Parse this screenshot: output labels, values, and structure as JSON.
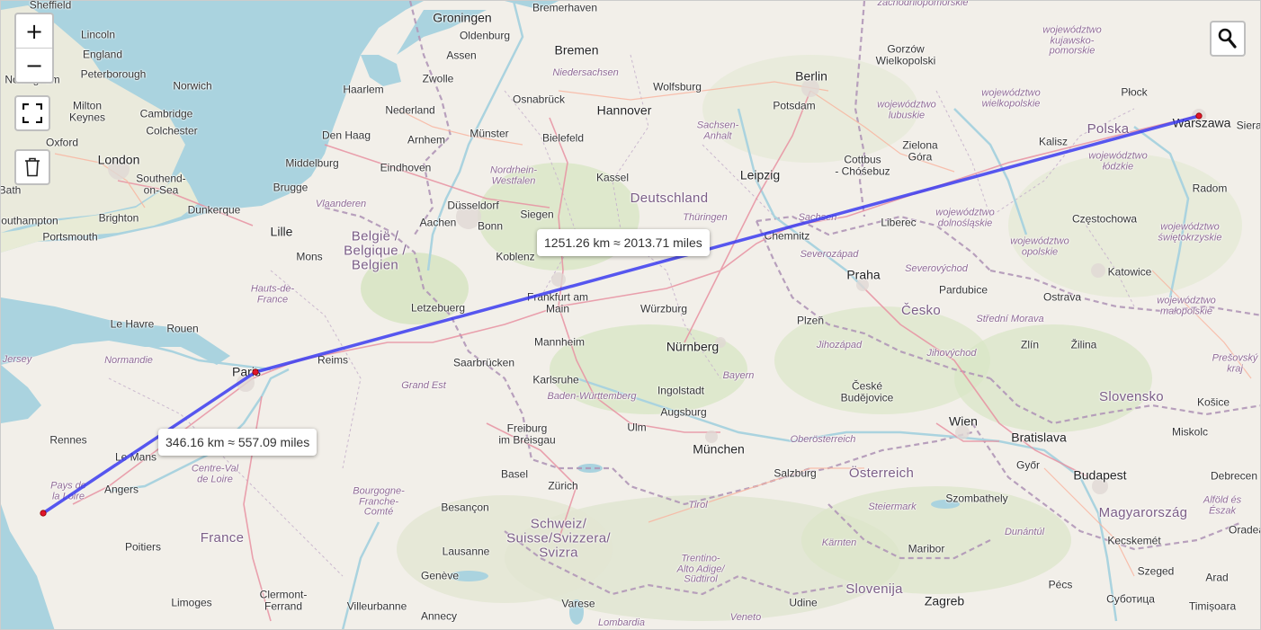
{
  "controls": {
    "zoom_in": "+",
    "zoom_out": "−",
    "fullscreen_icon": "fullscreen-icon",
    "delete_icon": "trash-icon",
    "search_icon": "search-icon"
  },
  "measurements": [
    {
      "text": "1251.26 km ≈ 2013.71 miles"
    },
    {
      "text": "346.16 km ≈ 557.09 miles"
    }
  ],
  "route": {
    "color": "#3b3bf0",
    "points": [
      "Nantes",
      "Paris",
      "Warszawa"
    ]
  },
  "labels": {
    "cities": [
      "Sheffield",
      "Lincoln",
      "Nottingham",
      "England",
      "Peterborough",
      "Norwich",
      "Milton Keynes",
      "Cambridge",
      "Colchester",
      "Oxford",
      "London",
      "Southend-on-Sea",
      "Bath",
      "Southampton",
      "Brighton",
      "Portsmouth",
      "Groningen",
      "Bremerhaven",
      "Oldenburg",
      "Bremen",
      "Assen",
      "Haarlem",
      "Zwolle",
      "Nederland",
      "Osnabrück",
      "Wolfsburg",
      "Hannover",
      "Berlin",
      "Potsdam",
      "Den Haag",
      "Arnhem",
      "Münster",
      "Bielefeld",
      "Middelburg",
      "Eindhoven",
      "Brugge",
      "Düsseldorf",
      "Kassel",
      "Leipzig",
      "Dunkerque",
      "Aachen",
      "Bonn",
      "Siegen",
      "Lille",
      "Mons",
      "Koblenz",
      "Letzebuerg",
      "Frankfurt am Main",
      "Würzburg",
      "Mannheim",
      "Saarbrücken",
      "Nürnberg",
      "Karlsruhe",
      "Ingolstadt",
      "Augsburg",
      "Freiburg im Breisgau",
      "Ulm",
      "München",
      "Reims",
      "Paris",
      "Le Havre",
      "Rouen",
      "Rennes",
      "Le Mans",
      "Angers",
      "Poitiers",
      "Limoges",
      "Clermont-Ferrand",
      "Villeurbanne",
      "Annecy",
      "Besançon",
      "Basel",
      "Zürich",
      "Lausanne",
      "Genève",
      "Varese",
      "Chemnitz",
      "Praha",
      "Pardubice",
      "Plzeň",
      "České Budějovice",
      "Ostrava",
      "Zlín",
      "Žilina",
      "Wien",
      "Bratislava",
      "Győr",
      "Budapest",
      "Salzburg",
      "Maribor",
      "Zagreb",
      "Szombathely",
      "Kecskemét",
      "Szeged",
      "Arad",
      "Debrecen",
      "Miskolc",
      "Košice",
      "Timișoara",
      "Oradea",
      "Pécs",
      "Суботица",
      "Udine",
      "Warszawa",
      "Płock",
      "Kalisz",
      "Radom",
      "Częstochowa",
      "Katowice",
      "Liberec",
      "Zielona Góra",
      "Gorzów Wielkopolski",
      "Cottbus Chóśebuz",
      "Sieradz"
    ],
    "countries": [
      "Deutschland",
      "Polska",
      "Belgique / België / Belgien",
      "France",
      "Česko",
      "Österreich",
      "Slovensko",
      "Magyarország",
      "Slovenija",
      "Schweiz/ Suisse/Svizzera/ Svizra"
    ],
    "regions": [
      "Niedersachsen",
      "Sachsen-Anhalt",
      "Nordrhein-Westfalen",
      "Thüringen",
      "Sachsen",
      "Vlaanderen",
      "Hauts-de-France",
      "Normandie",
      "Grand Est",
      "Bayern",
      "Baden-Württemberg",
      "Centre-Val de Loire",
      "Pays de la Loire",
      "Bourgogne-Franche-Comté",
      "Oberösterreich",
      "Steiermark",
      "Kärnten",
      "Tirol",
      "Trentino-Alto Adige/ Südtirol",
      "Lombardia",
      "Veneto",
      "Severozápad",
      "Severovýchod",
      "Jihozápad",
      "Jihovýchod",
      "Střední Morava",
      "województwo kujawsko-pomorskie",
      "województwo wielkopolskie",
      "województwo lubuskie",
      "województwo łódzkie",
      "województwo dolnośląskie",
      "województwo opolskie",
      "województwo świętokrzyskie",
      "województwo małopolskie",
      "Prešovský kraj",
      "Alföld és Észak",
      "Dunántúl",
      "zachodniopomorskie",
      "Jersey"
    ]
  }
}
